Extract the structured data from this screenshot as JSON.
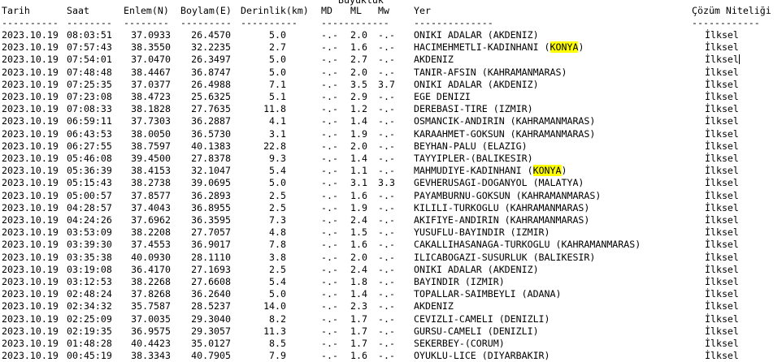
{
  "header": {
    "super_label": "Büyüklük",
    "columns": {
      "date": "Tarih",
      "time": "Saat",
      "lat": "Enlem(N)",
      "lon": "Boylam(E)",
      "depth": "Derinlik(km)",
      "md": "MD",
      "ml": "ML",
      "mw": "Mw",
      "location": "Yer",
      "quality": "Çözüm Niteliği"
    },
    "rules": {
      "date": "----------",
      "time": "--------",
      "lat": "--------",
      "lon": "---------",
      "depth": "----------",
      "mag": "------------",
      "location": "--------------",
      "quality": "------------"
    }
  },
  "highlight_word": "KONYA",
  "rows": [
    {
      "date": "2023.10.19",
      "time": "08:03:51",
      "lat": "37.0933",
      "lon": "26.4570",
      "depth": "5.0",
      "md": "-.-",
      "ml": "2.0",
      "mw": "-.-",
      "location": "ONIKI ADALAR (AKDENIZ)",
      "quality": "İlksel"
    },
    {
      "date": "2023.10.19",
      "time": "07:57:43",
      "lat": "38.3550",
      "lon": "32.2235",
      "depth": "2.7",
      "md": "-.-",
      "ml": "1.6",
      "mw": "-.-",
      "location": "HACIMEHMETLI-KADINHANI (KONYA)",
      "quality": "İlksel"
    },
    {
      "date": "2023.10.19",
      "time": "07:54:01",
      "lat": "37.0470",
      "lon": "26.3497",
      "depth": "5.0",
      "md": "-.-",
      "ml": "2.7",
      "mw": "-.-",
      "location": "AKDENIZ",
      "quality": "İlksel"
    },
    {
      "date": "2023.10.19",
      "time": "07:48:48",
      "lat": "38.4467",
      "lon": "36.8747",
      "depth": "5.0",
      "md": "-.-",
      "ml": "2.0",
      "mw": "-.-",
      "location": "TANIR-AFSIN (KAHRAMANMARAS)",
      "quality": "İlksel"
    },
    {
      "date": "2023.10.19",
      "time": "07:25:35",
      "lat": "37.0377",
      "lon": "26.4988",
      "depth": "7.1",
      "md": "-.-",
      "ml": "3.5",
      "mw": "3.7",
      "location": "ONIKI ADALAR (AKDENIZ)",
      "quality": "İlksel"
    },
    {
      "date": "2023.10.19",
      "time": "07:23:08",
      "lat": "38.4723",
      "lon": "25.6325",
      "depth": "5.1",
      "md": "-.-",
      "ml": "2.9",
      "mw": "-.-",
      "location": "EGE DENIZI",
      "quality": "İlksel"
    },
    {
      "date": "2023.10.19",
      "time": "07:08:33",
      "lat": "38.1828",
      "lon": "27.7635",
      "depth": "11.8",
      "md": "-.-",
      "ml": "1.2",
      "mw": "-.-",
      "location": "DEREBASI-TIRE (IZMIR)",
      "quality": "İlksel"
    },
    {
      "date": "2023.10.19",
      "time": "06:59:11",
      "lat": "37.7303",
      "lon": "36.2887",
      "depth": "4.1",
      "md": "-.-",
      "ml": "1.4",
      "mw": "-.-",
      "location": "OSMANCIK-ANDIRIN (KAHRAMANMARAS)",
      "quality": "İlksel"
    },
    {
      "date": "2023.10.19",
      "time": "06:43:53",
      "lat": "38.0050",
      "lon": "36.5730",
      "depth": "3.1",
      "md": "-.-",
      "ml": "1.9",
      "mw": "-.-",
      "location": "KARAAHMET-GOKSUN (KAHRAMANMARAS)",
      "quality": "İlksel"
    },
    {
      "date": "2023.10.19",
      "time": "06:27:55",
      "lat": "38.7597",
      "lon": "40.1383",
      "depth": "22.8",
      "md": "-.-",
      "ml": "2.0",
      "mw": "-.-",
      "location": "BEYHAN-PALU (ELAZIG)",
      "quality": "İlksel"
    },
    {
      "date": "2023.10.19",
      "time": "05:46:08",
      "lat": "39.4500",
      "lon": "27.8378",
      "depth": "9.3",
      "md": "-.-",
      "ml": "1.4",
      "mw": "-.-",
      "location": "TAYYIPLER-(BALIKESIR)",
      "quality": "İlksel"
    },
    {
      "date": "2023.10.19",
      "time": "05:36:39",
      "lat": "38.4153",
      "lon": "32.1047",
      "depth": "5.4",
      "md": "-.-",
      "ml": "1.1",
      "mw": "-.-",
      "location": "MAHMUDIYE-KADINHANI (KONYA)",
      "quality": "İlksel"
    },
    {
      "date": "2023.10.19",
      "time": "05:15:43",
      "lat": "38.2738",
      "lon": "39.0695",
      "depth": "5.0",
      "md": "-.-",
      "ml": "3.1",
      "mw": "3.3",
      "location": "GEVHERUSAGI-DOGANYOL (MALATYA)",
      "quality": "İlksel"
    },
    {
      "date": "2023.10.19",
      "time": "05:00:57",
      "lat": "37.8577",
      "lon": "36.2893",
      "depth": "2.5",
      "md": "-.-",
      "ml": "1.6",
      "mw": "-.-",
      "location": "PAYAMBURNU-GOKSUN (KAHRAMANMARAS)",
      "quality": "İlksel"
    },
    {
      "date": "2023.10.19",
      "time": "04:28:57",
      "lat": "37.4043",
      "lon": "36.8955",
      "depth": "2.5",
      "md": "-.-",
      "ml": "1.9",
      "mw": "-.-",
      "location": "KILILI-TURKOGLU (KAHRAMANMARAS)",
      "quality": "İlksel"
    },
    {
      "date": "2023.10.19",
      "time": "04:24:26",
      "lat": "37.6962",
      "lon": "36.3595",
      "depth": "7.3",
      "md": "-.-",
      "ml": "2.4",
      "mw": "-.-",
      "location": "AKIFIYE-ANDIRIN (KAHRAMANMARAS)",
      "quality": "İlksel"
    },
    {
      "date": "2023.10.19",
      "time": "03:53:09",
      "lat": "38.2208",
      "lon": "27.7057",
      "depth": "4.8",
      "md": "-.-",
      "ml": "1.5",
      "mw": "-.-",
      "location": "YUSUFLU-BAYINDIR (IZMIR)",
      "quality": "İlksel"
    },
    {
      "date": "2023.10.19",
      "time": "03:39:30",
      "lat": "37.4553",
      "lon": "36.9017",
      "depth": "7.8",
      "md": "-.-",
      "ml": "1.6",
      "mw": "-.-",
      "location": "CAKALLIHASANAGA-TURKOGLU (KAHRAMANMARAS)",
      "quality": "İlksel"
    },
    {
      "date": "2023.10.19",
      "time": "03:35:38",
      "lat": "40.0930",
      "lon": "28.1110",
      "depth": "3.8",
      "md": "-.-",
      "ml": "2.0",
      "mw": "-.-",
      "location": "ILICABOGAZI-SUSURLUK (BALIKESIR)",
      "quality": "İlksel"
    },
    {
      "date": "2023.10.19",
      "time": "03:19:08",
      "lat": "36.4170",
      "lon": "27.1693",
      "depth": "2.5",
      "md": "-.-",
      "ml": "2.4",
      "mw": "-.-",
      "location": "ONIKI ADALAR (AKDENIZ)",
      "quality": "İlksel"
    },
    {
      "date": "2023.10.19",
      "time": "03:12:53",
      "lat": "38.2268",
      "lon": "27.6608",
      "depth": "5.4",
      "md": "-.-",
      "ml": "1.8",
      "mw": "-.-",
      "location": "BAYINDIR (IZMIR)",
      "quality": "İlksel"
    },
    {
      "date": "2023.10.19",
      "time": "02:48:24",
      "lat": "37.8268",
      "lon": "36.2640",
      "depth": "5.0",
      "md": "-.-",
      "ml": "1.4",
      "mw": "-.-",
      "location": "TOPALLAR-SAIMBEYLI (ADANA)",
      "quality": "İlksel"
    },
    {
      "date": "2023.10.19",
      "time": "02:34:32",
      "lat": "35.7587",
      "lon": "28.5237",
      "depth": "14.0",
      "md": "-.-",
      "ml": "2.3",
      "mw": "-.-",
      "location": "AKDENIZ",
      "quality": "İlksel"
    },
    {
      "date": "2023.10.19",
      "time": "02:25:09",
      "lat": "37.0035",
      "lon": "29.3040",
      "depth": "8.2",
      "md": "-.-",
      "ml": "1.7",
      "mw": "-.-",
      "location": "CEVIZLI-CAMELI (DENIZLI)",
      "quality": "İlksel"
    },
    {
      "date": "2023.10.19",
      "time": "02:19:35",
      "lat": "36.9575",
      "lon": "29.3057",
      "depth": "11.3",
      "md": "-.-",
      "ml": "1.7",
      "mw": "-.-",
      "location": "GURSU-CAMELI (DENIZLI)",
      "quality": "İlksel"
    },
    {
      "date": "2023.10.19",
      "time": "01:48:28",
      "lat": "40.4423",
      "lon": "35.0127",
      "depth": "8.5",
      "md": "-.-",
      "ml": "1.7",
      "mw": "-.-",
      "location": "SEKERBEY-(CORUM)",
      "quality": "İlksel"
    },
    {
      "date": "2023.10.19",
      "time": "00:45:19",
      "lat": "38.3343",
      "lon": "40.7905",
      "depth": "7.9",
      "md": "-.-",
      "ml": "1.6",
      "mw": "-.-",
      "location": "OYUKLU-LICE (DIYARBAKIR)",
      "quality": "İlksel"
    }
  ]
}
